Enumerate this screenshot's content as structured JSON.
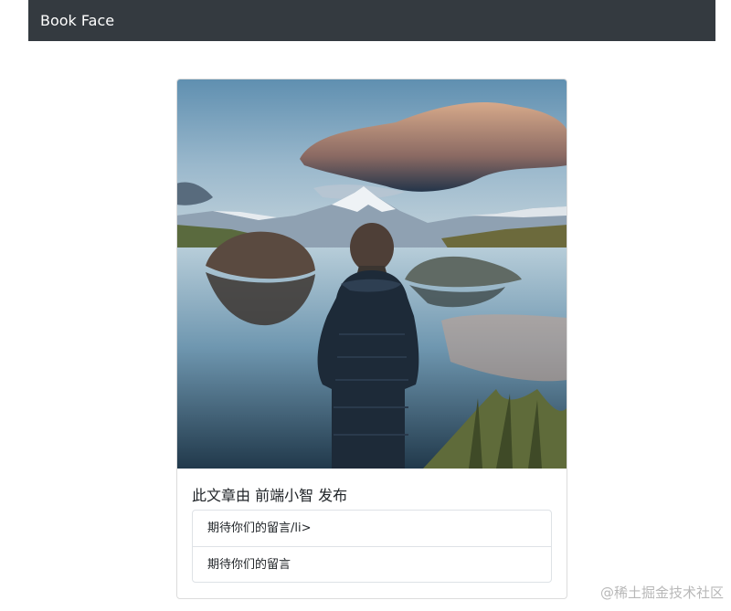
{
  "navbar": {
    "brand": "Book Face"
  },
  "card": {
    "image_alt": "Man in a puffer jacket standing before a mountain lake",
    "title": "此文章由 前端小智 发布",
    "items": [
      {
        "text": "期待你们的留言/li>"
      },
      {
        "text": "期待你们的留言"
      }
    ]
  },
  "watermark": "@稀土掘金技术社区"
}
